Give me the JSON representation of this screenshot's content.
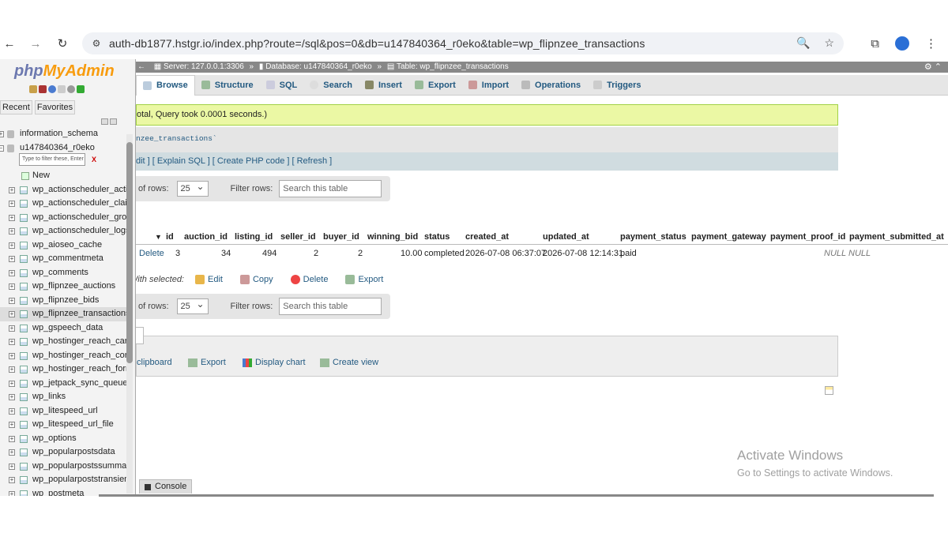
{
  "browser": {
    "url": "auth-db1877.hstgr.io/index.php?route=/sql&pos=0&db=u147840364_r0eko&table=wp_flipnzee_transactions"
  },
  "sidebar": {
    "logo_php": "php",
    "logo_myadmin": "MyAdmin",
    "tab_recent": "Recent",
    "tab_favorites": "Favorites",
    "filter_placeholder": "Type to filter these, Enter",
    "filter_clear": "X",
    "databases": [
      "information_schema",
      "u147840364_r0eko"
    ],
    "new_label": "New",
    "tables": [
      "wp_actionscheduler_actio",
      "wp_actionscheduler_claim",
      "wp_actionscheduler_group",
      "wp_actionscheduler_logs",
      "wp_aioseo_cache",
      "wp_commentmeta",
      "wp_comments",
      "wp_flipnzee_auctions",
      "wp_flipnzee_bids",
      "wp_flipnzee_transactions",
      "wp_gspeech_data",
      "wp_hostinger_reach_carts",
      "wp_hostinger_reach_conta",
      "wp_hostinger_reach_form",
      "wp_jetpack_sync_queue",
      "wp_links",
      "wp_litespeed_url",
      "wp_litespeed_url_file",
      "wp_options",
      "wp_popularpostsdata",
      "wp_popularpostssummary",
      "wp_popularpoststransients",
      "wp_postmeta"
    ],
    "selected_table": "wp_flipnzee_transactions"
  },
  "breadcrumb": {
    "server": "Server: 127.0.0.1:3306",
    "database": "Database: u147840364_r0eko",
    "table": "Table: wp_flipnzee_transactions",
    "sep": "»"
  },
  "tabs": [
    "Browse",
    "Structure",
    "SQL",
    "Search",
    "Insert",
    "Export",
    "Import",
    "Operations",
    "Triggers"
  ],
  "success_message": "otal, Query took 0.0001 seconds.)",
  "sql_query": "nzee_transactions`",
  "sql_links": "dit ] [ Explain SQL ] [ Create PHP code ] [ Refresh ]",
  "nav": {
    "rows_label": "of rows:",
    "rows_value": "25",
    "filter_label": "Filter rows:",
    "filter_placeholder": "Search this table"
  },
  "table": {
    "sort_arrow": "▼",
    "columns": [
      "id",
      "auction_id",
      "listing_id",
      "seller_id",
      "buyer_id",
      "winning_bid",
      "status",
      "created_at",
      "updated_at",
      "payment_status",
      "payment_gateway",
      "payment_proof_id",
      "payment_submitted_at"
    ],
    "row": {
      "action": "Delete",
      "id": "3",
      "auction_id": "34",
      "listing_id": "494",
      "seller_id": "2",
      "buyer_id": "2",
      "winning_bid": "10.00",
      "status": "completed",
      "created_at": "2026-07-08 06:37:07",
      "updated_at": "2026-07-08 12:14:31",
      "payment_status": "paid",
      "payment_gateway": "",
      "payment_proof_id": "NULL",
      "payment_submitted_at": "NULL"
    }
  },
  "with_selected": {
    "label": "With selected:",
    "edit": "Edit",
    "copy": "Copy",
    "delete": "Delete",
    "export": "Export"
  },
  "query_ops": {
    "clipboard": "clipboard",
    "export": "Export",
    "display_chart": "Display chart",
    "create_view": "Create view"
  },
  "console": "Console",
  "activate": {
    "title": "Activate Windows",
    "subtitle": "Go to Settings to activate Windows."
  }
}
